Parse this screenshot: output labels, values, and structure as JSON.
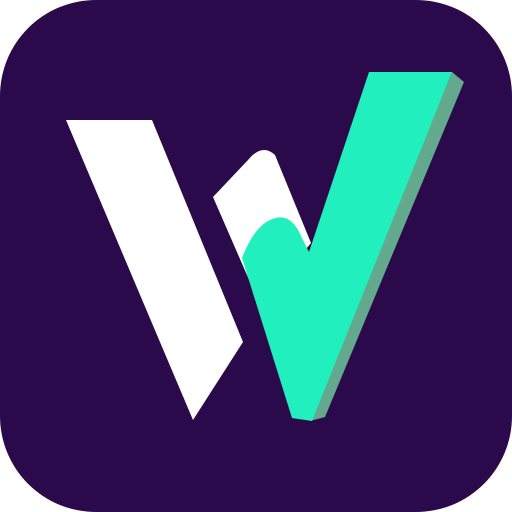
{
  "icon": {
    "name": "w-checkmark-logo-icon",
    "colors": {
      "background": "#2B0A4B",
      "white_stroke": "#FFFFFF",
      "accent": "#21F0BE",
      "accent_shadow": "#62A98E"
    }
  }
}
